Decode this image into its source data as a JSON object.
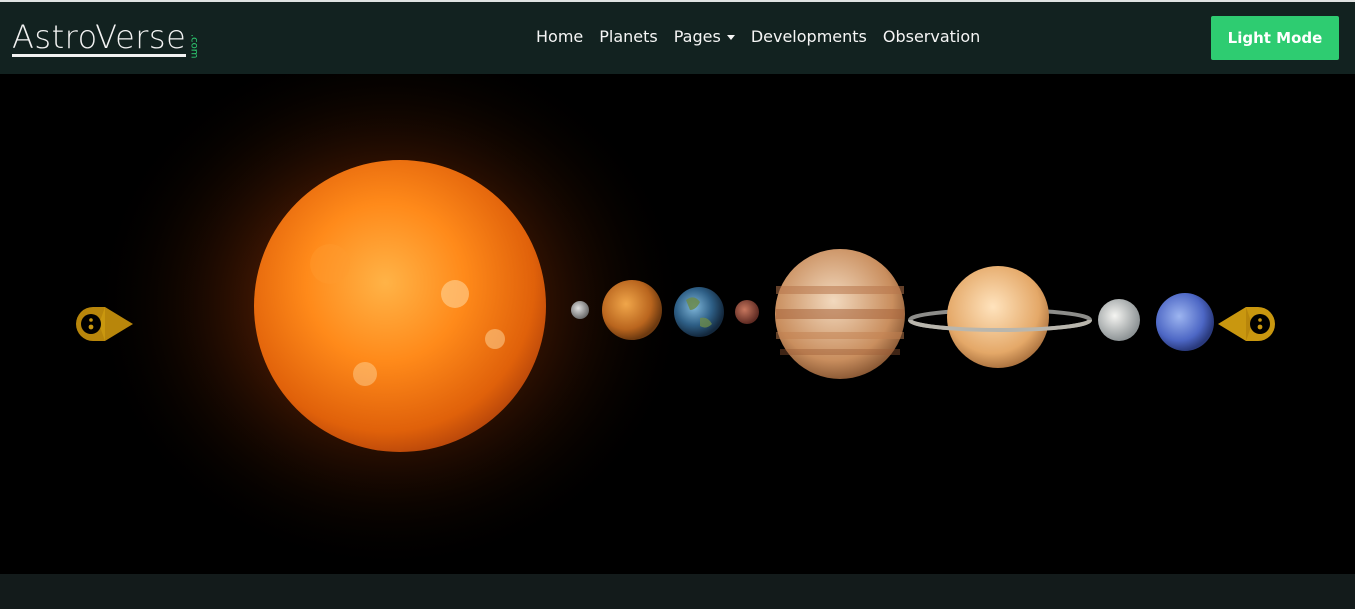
{
  "brand": {
    "name_part1": "Astro",
    "name_part2": "Verse",
    "suffix": ".com"
  },
  "nav": {
    "items": [
      {
        "label": "Home"
      },
      {
        "label": "Planets"
      },
      {
        "label": "Pages",
        "dropdown": true
      },
      {
        "label": "Developments"
      },
      {
        "label": "Observation"
      }
    ]
  },
  "mode_button": {
    "label": "Light Mode"
  },
  "carousel": {
    "slide_image": "solar-system",
    "prev_control_icon": "rocket-prev-icon",
    "next_control_icon": "rocket-next-icon",
    "bodies": [
      "sun",
      "mercury",
      "venus",
      "earth",
      "mars",
      "jupiter",
      "saturn",
      "uranus",
      "neptune"
    ]
  },
  "colors": {
    "navbar_bg": "#122220",
    "accent_green": "#2ecc71",
    "control_gold": "#b8860b",
    "page_bg": "#111b1a"
  }
}
